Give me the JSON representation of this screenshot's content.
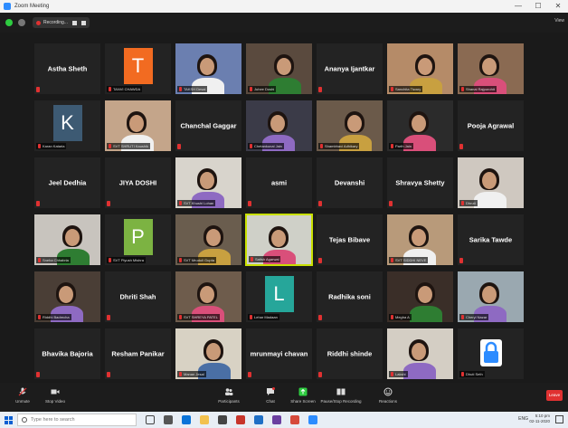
{
  "window": {
    "title": "Zoom Meeting",
    "min": "—",
    "max": "☐",
    "close": "✕"
  },
  "topbar": {
    "recording_label": "Recording...",
    "view_label": "View"
  },
  "tiles": [
    {
      "display": "Astha Sheth",
      "type": "name"
    },
    {
      "display": "T",
      "label": "TANVI CHAWDA",
      "type": "letter",
      "bg": "#f26b21"
    },
    {
      "display": "",
      "label": "TAKSH Desai",
      "type": "video",
      "bg": "#6b7fb0"
    },
    {
      "display": "",
      "label": "Juhee Doshi",
      "type": "video",
      "bg": "#5a4a3e"
    },
    {
      "display": "Ananya Ijantkar",
      "type": "name"
    },
    {
      "display": "",
      "label": "Sanchita Tiwary",
      "type": "video",
      "bg": "#b58b68"
    },
    {
      "display": "",
      "label": "Shanai Rajpurohit",
      "type": "video",
      "bg": "#8a6a52"
    },
    {
      "display": "K",
      "label": "Karan Kataria",
      "type": "letter",
      "bg": "#3d5a73"
    },
    {
      "display": "",
      "label": "SVT SHRUTI Kaushik",
      "type": "video",
      "bg": "#c4a58a"
    },
    {
      "display": "Chanchal Gaggar",
      "type": "name"
    },
    {
      "display": "",
      "label": "Chetankunal Jain",
      "type": "video",
      "bg": "#3b3b48"
    },
    {
      "display": "",
      "label": "Shambhavi Adhikary",
      "type": "video",
      "bg": "#6b5a4a"
    },
    {
      "display": "",
      "label": "Parth Jain",
      "type": "video",
      "bg": "#2b2b2b"
    },
    {
      "display": "Pooja Agrawal",
      "type": "name"
    },
    {
      "display": "Jeel Dedhia",
      "type": "name"
    },
    {
      "display": "JIYA DOSHI",
      "type": "name"
    },
    {
      "display": "",
      "label": "SVT Khushi Lohan",
      "type": "video",
      "bg": "#d8d4cc"
    },
    {
      "display": "asmi",
      "type": "name"
    },
    {
      "display": "Devanshi",
      "type": "name"
    },
    {
      "display": "Shravya Shetty",
      "type": "name"
    },
    {
      "display": "",
      "label": "Dhruti",
      "type": "video",
      "bg": "#cfc8c0"
    },
    {
      "display": "",
      "label": "Sneha Chhabria",
      "type": "video",
      "bg": "#c8c4be"
    },
    {
      "display": "P",
      "label": "SVT Piyush Mishra",
      "type": "letter",
      "bg": "#7cb342"
    },
    {
      "display": "",
      "label": "SVT Mruduli Gupta",
      "type": "video",
      "bg": "#6a5d4e"
    },
    {
      "display": "",
      "label": "Satish Agarwal",
      "type": "video",
      "bg": "#cfd0c8",
      "speaking": true
    },
    {
      "display": "Tejas Bibave",
      "type": "name"
    },
    {
      "display": "",
      "label": "SVT SIDDHI NEVE",
      "type": "video",
      "bg": "#b89a7a"
    },
    {
      "display": "Sarika Tawde",
      "type": "name"
    },
    {
      "display": "",
      "label": "Riddhi Badrecha",
      "type": "video",
      "bg": "#4a3e36"
    },
    {
      "display": "Dhriti Shah",
      "type": "name"
    },
    {
      "display": "",
      "label": "SVT SHREYA PATEL",
      "type": "video",
      "bg": "#6e5c4c"
    },
    {
      "display": "L",
      "label": "Lehar Madaan",
      "type": "letter",
      "bg": "#26a69a"
    },
    {
      "display": "Radhika soni",
      "type": "name"
    },
    {
      "display": "",
      "label": "Megha A",
      "type": "video",
      "bg": "#3a2e28"
    },
    {
      "display": "",
      "label": "Cheryl Nazar",
      "type": "video",
      "bg": "#9aa8b0"
    },
    {
      "display": "Bhavika Bajoria",
      "type": "name"
    },
    {
      "display": "Resham Panikar",
      "type": "name"
    },
    {
      "display": "",
      "label": "Manan Jesal",
      "type": "video",
      "bg": "#d8d2c4"
    },
    {
      "display": "mrunmayi chavan",
      "type": "name"
    },
    {
      "display": "Riddhi shinde",
      "type": "name"
    },
    {
      "display": "",
      "label": "Lakshi",
      "type": "video",
      "bg": "#d4cec4"
    },
    {
      "display": "",
      "label": "Dhuti Seth",
      "type": "lock",
      "bg": "#232323"
    }
  ],
  "toolbar": {
    "unmute": "Unmute",
    "stop_video": "Stop Video",
    "participants": "Participants",
    "participants_count": "42",
    "chat": "Chat",
    "share_screen": "Share Screen",
    "recording": "Pause/Stop Recording",
    "reactions": "Reactions",
    "leave": "Leave"
  },
  "taskbar": {
    "search_placeholder": "Type here to search",
    "tray": "ENG",
    "time": "5:10 pm",
    "date": "02-11-2020"
  },
  "colors": {
    "accent": "#2d8cff",
    "danger": "#e03131",
    "share": "#2ecc40",
    "speaking": "#c8e000"
  }
}
